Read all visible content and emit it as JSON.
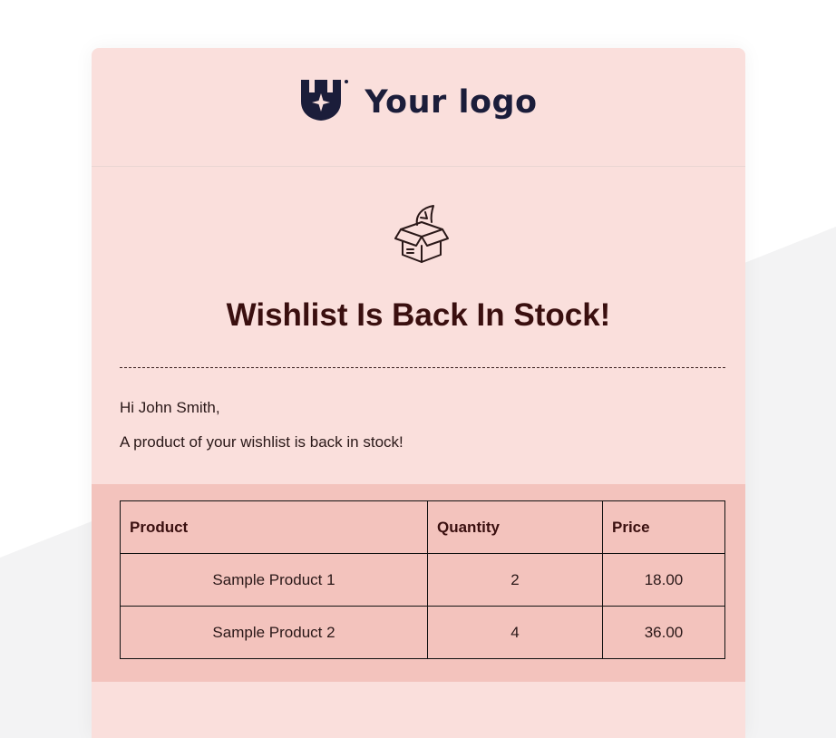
{
  "header": {
    "logo_text": "Your logo",
    "logo_icon": "shield-star-icon"
  },
  "hero": {
    "icon": "open-box-icon",
    "title": "Wishlist Is Back In Stock!"
  },
  "body": {
    "greeting": "Hi John Smith,",
    "message": "A product of your wishlist is back in stock!"
  },
  "table": {
    "headers": [
      "Product",
      "Quantity",
      "Price"
    ],
    "rows": [
      [
        "Sample Product 1",
        "2",
        "18.00"
      ],
      [
        "Sample Product 2",
        "4",
        "36.00"
      ]
    ]
  },
  "colors": {
    "card_background": "#fadfdc",
    "table_band": "#f3c3bd",
    "title": "#3a0f0f",
    "logo": "#1b1d3a"
  }
}
